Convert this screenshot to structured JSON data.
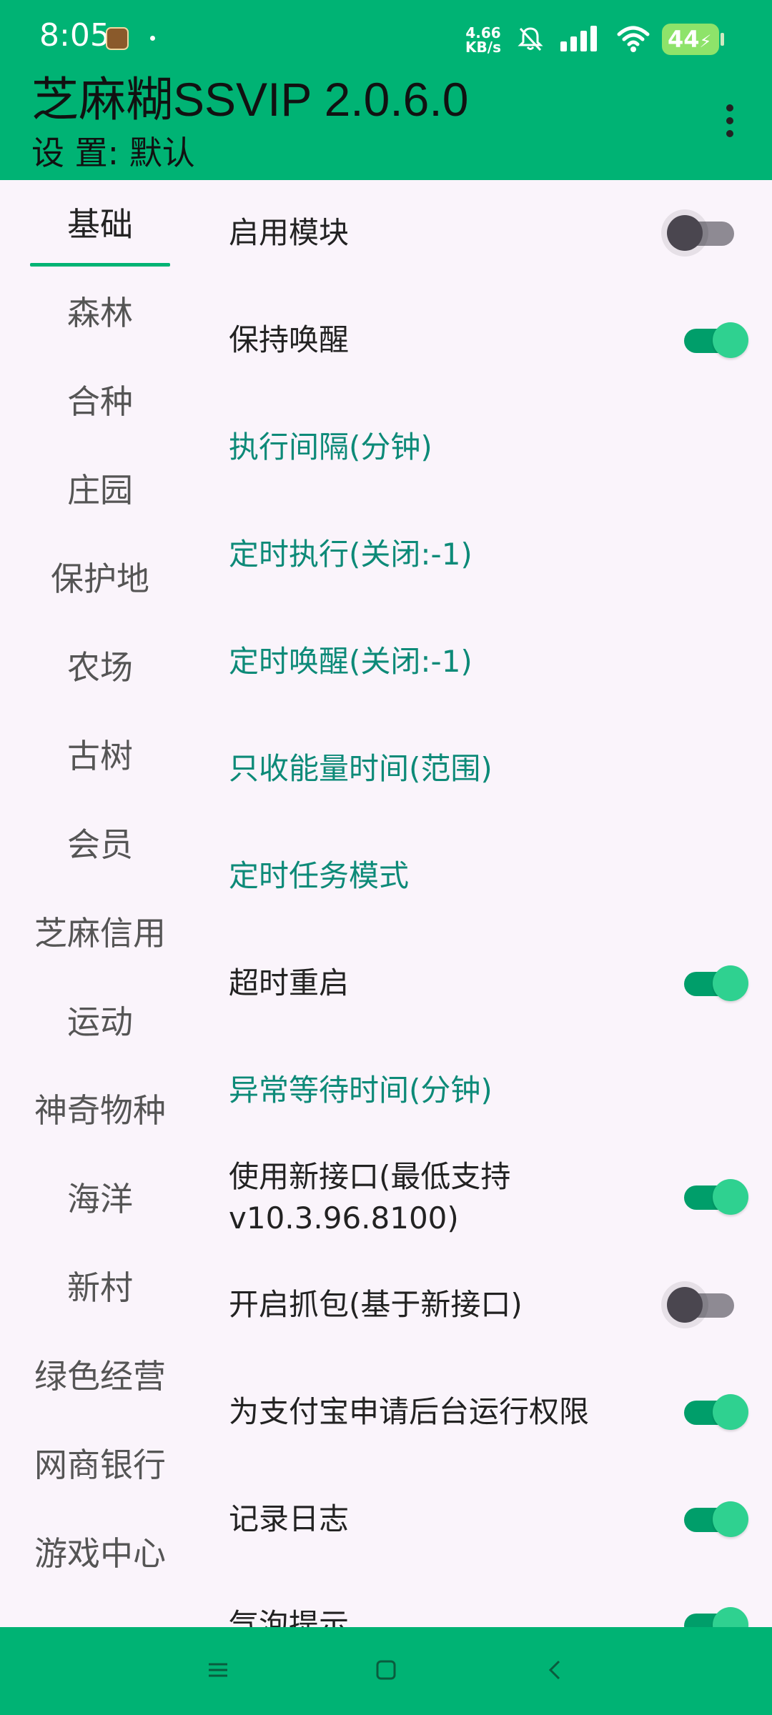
{
  "status_bar": {
    "time": "8:05",
    "net_speed_value": "4.66",
    "net_speed_unit": "KB/s",
    "battery": "44"
  },
  "app_bar": {
    "title": "芝麻糊SSVIP 2.0.6.0",
    "subtitle": "设 置: 默认"
  },
  "sidebar": {
    "items": [
      {
        "label": "基础",
        "active": true
      },
      {
        "label": "森林"
      },
      {
        "label": "合种"
      },
      {
        "label": "庄园"
      },
      {
        "label": "保护地"
      },
      {
        "label": "农场"
      },
      {
        "label": "古树"
      },
      {
        "label": "会员"
      },
      {
        "label": "芝麻信用"
      },
      {
        "label": "运动"
      },
      {
        "label": "神奇物种"
      },
      {
        "label": "海洋"
      },
      {
        "label": "新村"
      },
      {
        "label": "绿色经营"
      },
      {
        "label": "网商银行"
      },
      {
        "label": "游戏中心"
      }
    ]
  },
  "settings": {
    "items": [
      {
        "label": "启用模块",
        "type": "toggle",
        "on": false
      },
      {
        "label": "保持唤醒",
        "type": "toggle",
        "on": true
      },
      {
        "label": "执行间隔(分钟)",
        "type": "link"
      },
      {
        "label": "定时执行(关闭:-1)",
        "type": "link"
      },
      {
        "label": "定时唤醒(关闭:-1)",
        "type": "link"
      },
      {
        "label": "只收能量时间(范围)",
        "type": "link"
      },
      {
        "label": "定时任务模式",
        "type": "link"
      },
      {
        "label": "超时重启",
        "type": "toggle",
        "on": true
      },
      {
        "label": "异常等待时间(分钟)",
        "type": "link"
      },
      {
        "label": "使用新接口(最低支持",
        "label_line2": "v10.3.96.8100)",
        "type": "toggle",
        "on": true
      },
      {
        "label": "开启抓包(基于新接口)",
        "type": "toggle",
        "on": false
      },
      {
        "label": "为支付宝申请后台运行权限",
        "type": "toggle",
        "on": true
      },
      {
        "label": "记录日志",
        "type": "toggle",
        "on": true
      },
      {
        "label": "气泡提示",
        "type": "toggle",
        "on": true
      }
    ]
  },
  "colors": {
    "primary": "#00b374",
    "link_text": "#0d8a78",
    "background": "#faf4fb"
  },
  "nav_bar": {
    "icons": [
      "menu-icon",
      "home-icon",
      "back-icon"
    ]
  }
}
